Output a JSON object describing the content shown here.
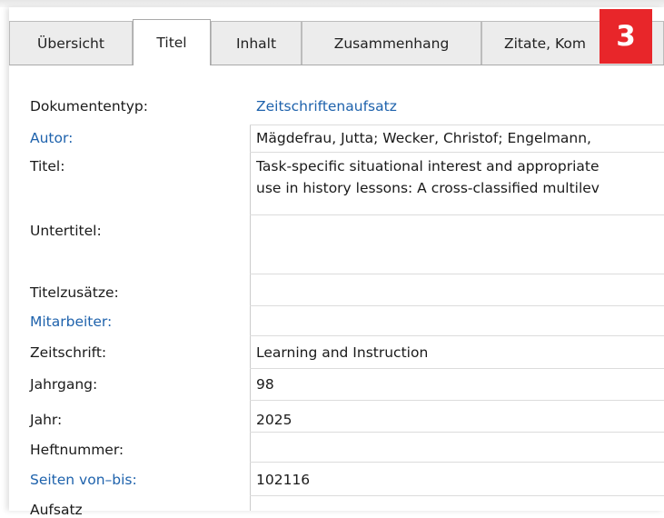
{
  "tabs": [
    {
      "label": "Übersicht",
      "active": false
    },
    {
      "label": "Titel",
      "active": true
    },
    {
      "label": "Inhalt",
      "active": false
    },
    {
      "label": "Zusammenhang",
      "active": false
    },
    {
      "label": "Zitate, Kom",
      "active": false
    }
  ],
  "badge": "3",
  "fields": {
    "dokumententyp": {
      "label": "Dokumententyp:",
      "value": "Zeitschriftenaufsatz"
    },
    "autor": {
      "label": "Autor:",
      "value": "Mägdefrau, Jutta; Wecker, Christof; Engelmann, "
    },
    "titel": {
      "label": "Titel:",
      "value_line1": "Task-specific situational interest and appropriate",
      "value_line2": "use in history lessons: A cross-classified multilev"
    },
    "untertitel": {
      "label": "Untertitel:",
      "value": ""
    },
    "titelzusaetze": {
      "label": "Titelzusätze:",
      "value": ""
    },
    "mitarbeiter": {
      "label": "Mitarbeiter:",
      "value": ""
    },
    "zeitschrift": {
      "label": "Zeitschrift:",
      "value": "Learning and Instruction"
    },
    "jahrgang": {
      "label": "Jahrgang:",
      "value": "98"
    },
    "jahr": {
      "label": "Jahr:",
      "value": "2025"
    },
    "heftnummer": {
      "label": "Heftnummer:",
      "value": ""
    },
    "seiten": {
      "label": "Seiten von–bis:",
      "value": "102116"
    },
    "next": {
      "label": "Aufsatz"
    }
  },
  "colors": {
    "link": "#1e62ac",
    "badge": "#e8262a"
  }
}
